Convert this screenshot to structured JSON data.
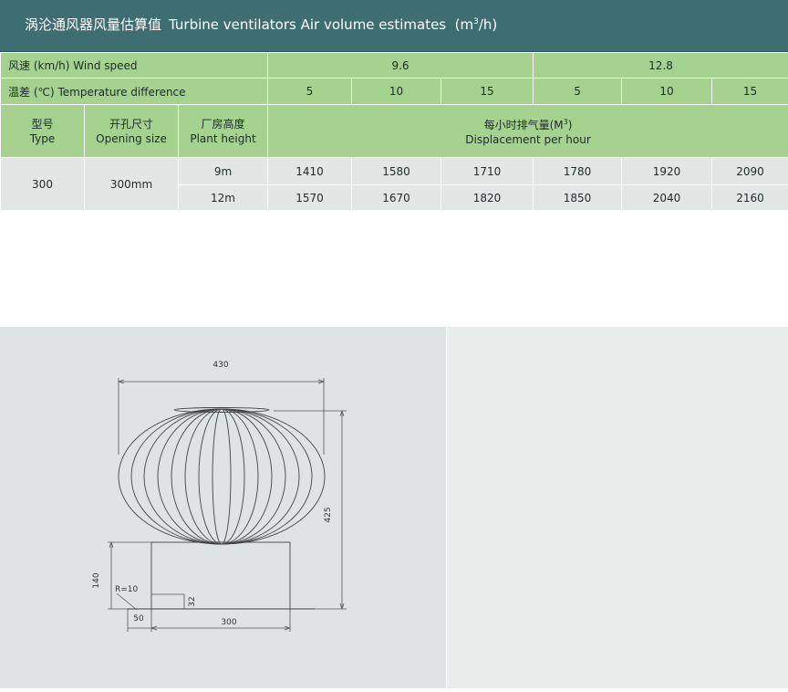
{
  "header": {
    "title_cn": "涡沦通风器风量估算值",
    "title_en": "Turbine ventilators Air volume estimates",
    "unit_pre": "(m",
    "unit_sup": "3",
    "unit_post": "/h)"
  },
  "table": {
    "wind_speed_label": "风速 (km/h)  Wind speed",
    "wind_speeds": [
      "9.6",
      "12.8"
    ],
    "temp_label": "温差 (℃)  Temperature difference",
    "temps": [
      "5",
      "10",
      "15",
      "5",
      "10",
      "15"
    ],
    "col_type_cn": "型号",
    "col_type_en": "Type",
    "col_opening_cn": "开孔尺寸",
    "col_opening_en": "Opening size",
    "col_height_cn": "厂房高度",
    "col_height_en": "Plant height",
    "col_disp_cn": "每小时排气量(M",
    "col_disp_sup": "3",
    "col_disp_cn_end": ")",
    "col_disp_en": "Displacement per hour",
    "type_value": "300",
    "opening_value": "300mm",
    "rows": [
      {
        "height": "9m",
        "values": [
          "1410",
          "1580",
          "1710",
          "1780",
          "1920",
          "2090"
        ]
      },
      {
        "height": "12m",
        "values": [
          "1570",
          "1670",
          "1820",
          "1850",
          "2040",
          "2160"
        ]
      }
    ]
  },
  "drawing": {
    "dim_width": "430",
    "dim_height": "425",
    "dim_neck": "140",
    "dim_radius": "R=10",
    "dim_flange": "32",
    "dim_offset": "50",
    "dim_base": "300"
  }
}
